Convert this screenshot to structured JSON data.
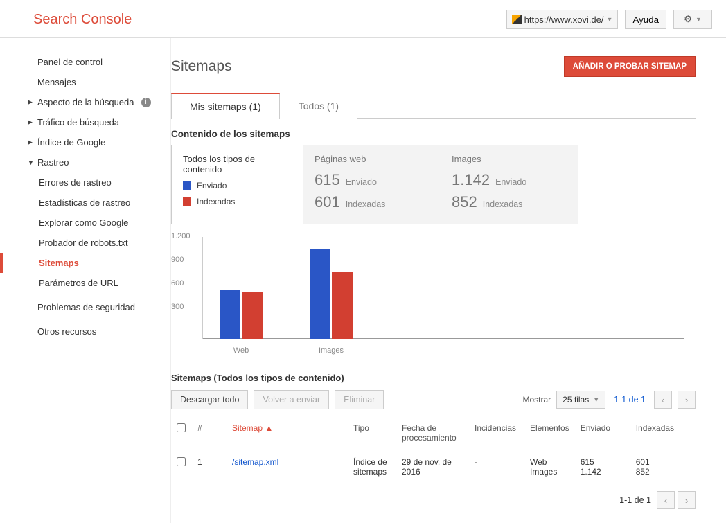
{
  "brand": "Search Console",
  "header": {
    "property": "https://www.xovi.de/",
    "help": "Ayuda"
  },
  "sidebar": {
    "panel": "Panel de control",
    "mensajes": "Mensajes",
    "aspecto": "Aspecto de la búsqueda",
    "trafico": "Tráfico de búsqueda",
    "indice": "Índice de Google",
    "rastreo": "Rastreo",
    "rastreo_items": {
      "errores": "Errores de rastreo",
      "estad": "Estadísticas de rastreo",
      "explorar": "Explorar como Google",
      "robots": "Probador de robots.txt",
      "sitemaps": "Sitemaps",
      "params": "Parámetros de URL"
    },
    "seguridad": "Problemas de seguridad",
    "otros": "Otros recursos"
  },
  "page": {
    "title": "Sitemaps",
    "add_btn": "AÑADIR O PROBAR SITEMAP"
  },
  "tabs": {
    "mine": "Mis sitemaps (1)",
    "all": "Todos (1)"
  },
  "content_section": "Contenido de los sitemaps",
  "legend": {
    "title": "Todos los tipos de contenido",
    "sent": "Enviado",
    "indexed": "Indexadas"
  },
  "summary": {
    "web": {
      "title": "Páginas web",
      "sent_n": "615",
      "sent_l": "Enviado",
      "idx_n": "601",
      "idx_l": "Indexadas"
    },
    "img": {
      "title": "Images",
      "sent_n": "1.142",
      "sent_l": "Enviado",
      "idx_n": "852",
      "idx_l": "Indexadas"
    }
  },
  "chart_data": {
    "type": "bar",
    "y_ticks": [
      "300",
      "600",
      "900",
      "1.200"
    ],
    "ylim": [
      0,
      1300
    ],
    "categories": [
      "Web",
      "Images"
    ],
    "series": [
      {
        "name": "Enviado",
        "color": "#2a56c6",
        "values": [
          615,
          1142
        ]
      },
      {
        "name": "Indexadas",
        "color": "#d23f31",
        "values": [
          601,
          852
        ]
      }
    ]
  },
  "table": {
    "title": "Sitemaps (Todos los tipos de contenido)",
    "download": "Descargar todo",
    "resend": "Volver a enviar",
    "delete": "Eliminar",
    "show": "Mostrar",
    "rows_sel": "25 filas",
    "pager": "1-1 de 1",
    "cols": {
      "num": "#",
      "sitemap": "Sitemap",
      "sort_arrow": "▲",
      "tipo": "Tipo",
      "fecha": "Fecha de procesamiento",
      "incid": "Incidencias",
      "elem": "Elementos",
      "env": "Enviado",
      "idx": "Indexadas"
    },
    "rows": [
      {
        "num": "1",
        "sitemap": "/sitemap.xml",
        "tipo": "Índice de sitemaps",
        "fecha": "29 de nov. de 2016",
        "incid": "-",
        "elem": [
          "Web",
          "Images"
        ],
        "env": [
          "615",
          "1.142"
        ],
        "idx": [
          "601",
          "852"
        ]
      }
    ]
  }
}
